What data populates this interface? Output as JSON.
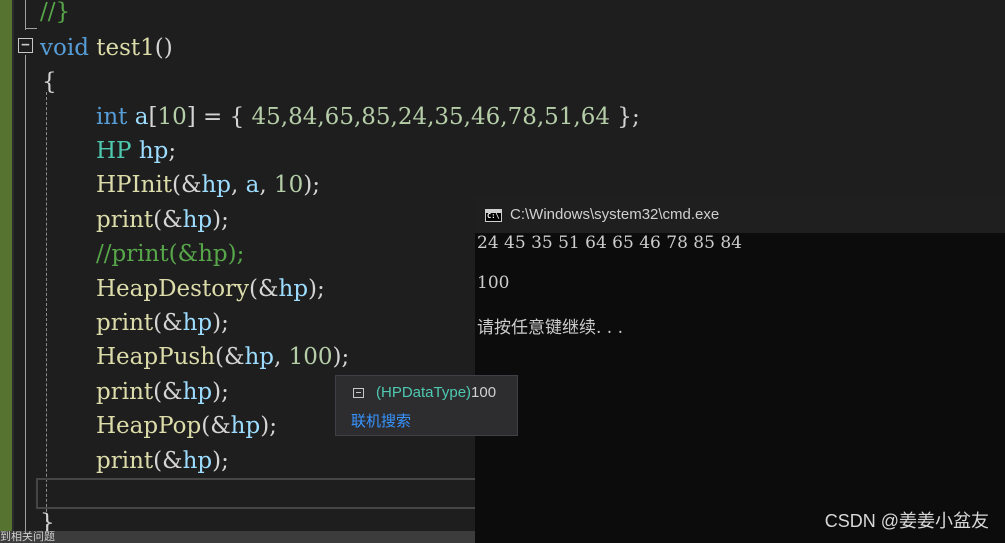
{
  "editor": {
    "prev_close": "//}",
    "sig_kw": "void",
    "sig_name": "test1",
    "sig_parens": "()",
    "open_brace": "{",
    "close_brace": "}",
    "l_decl": {
      "type": "int",
      "var": "a",
      "lb": "[",
      "size": "10",
      "rest": "] = { ",
      "values": "45,84,65,85,24,35,46,78,51,64",
      "end": " };"
    },
    "l_hp": {
      "type": "HP",
      "var": "hp",
      "end": ";"
    },
    "l_init": {
      "fn": "HPInit",
      "open": "(&",
      "a1": "hp",
      "sep": ", ",
      "a2": "a",
      "sep2": ", ",
      "n": "10",
      "end": ");"
    },
    "l_print1": {
      "fn": "print",
      "open": "(&",
      "arg": "hp",
      "end": ");"
    },
    "l_comment": "//print(&hp);",
    "l_destroy": {
      "fn": "HeapDestory",
      "open": "(&",
      "arg": "hp",
      "end": ");"
    },
    "l_print2": {
      "fn": "print",
      "open": "(&",
      "arg": "hp",
      "end": ");"
    },
    "l_push": {
      "fn": "HeapPush",
      "open": "(&",
      "arg": "hp",
      "sep": ", ",
      "n": "100",
      "end": ");"
    },
    "l_print3": {
      "fn": "print",
      "open": "(&",
      "arg": "hp",
      "end": ");"
    },
    "l_pop": {
      "fn": "HeapPop",
      "open": "(&",
      "arg": "hp",
      "end": ");"
    },
    "l_print4": {
      "fn": "print",
      "open": "(&",
      "arg": "hp",
      "end": ");"
    },
    "fold_symbol": "−"
  },
  "bottom_strip": "到相关问题",
  "cmd": {
    "title": "C:\\Windows\\system32\\cmd.exe",
    "icon_glyph": "C:\\",
    "lines": [
      "24 45 35 51 64 65 46 78 85 84",
      "100",
      "请按任意键继续. . ."
    ]
  },
  "tooltip": {
    "type": "(HPDataType)",
    "value": "100",
    "link": "联机搜索"
  },
  "watermark": "CSDN @姜姜小盆友"
}
